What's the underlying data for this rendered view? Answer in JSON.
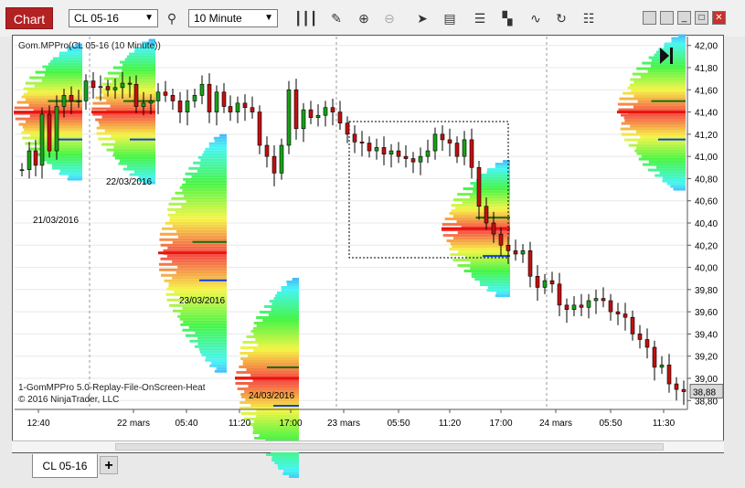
{
  "window": {
    "chart_tab_label": "Chart",
    "instrument": "CL 05-16",
    "interval": "10 Minute"
  },
  "toolbar_icons": [
    "bars-icon",
    "pencil-icon",
    "zoom-in-icon",
    "zoom-out-icon",
    "pointer-icon",
    "data-box-icon",
    "strategies-icon",
    "templates-icon",
    "indicators-icon",
    "reload-icon",
    "properties-icon"
  ],
  "window_controls": [
    "tile-icon",
    "minimize-icon",
    "maximize-icon",
    "close-icon"
  ],
  "chart": {
    "indicator_label": "Gom.MPPro(CL 05-16 (10 Minute))",
    "footer_line1": "1-GomMPPro 5.0-Replay-File-OnScreen-Heat",
    "footer_line2": "© 2016 NinjaTrader, LLC",
    "last_price": "38,88",
    "y_labels": [
      "42,00",
      "41,80",
      "41,60",
      "41,40",
      "41,20",
      "41,00",
      "40,80",
      "40,60",
      "40,40",
      "40,20",
      "40,00",
      "39,80",
      "39,60",
      "39,40",
      "39,20",
      "39,00",
      "38,80"
    ],
    "x_labels": [
      "12:40",
      "22 mars",
      "05:40",
      "11:20",
      "17:00",
      "23 mars",
      "05:50",
      "11:20",
      "17:00",
      "24 mars",
      "05:50",
      "11:30"
    ],
    "session_labels": [
      "21/03/2016",
      "22/03/2016",
      "23/03/2016",
      "24/03/2016"
    ],
    "colors": {
      "poc": "#e8140a",
      "va": "#107010",
      "hvn": "#1040e0",
      "frame": "#555555"
    }
  },
  "tabs": {
    "doc_tab": "CL 05-16",
    "add": "+"
  },
  "chart_data": {
    "type": "candlestick",
    "ylim": [
      38.72,
      42.08
    ],
    "y_ticks": [
      42.0,
      41.8,
      41.6,
      41.4,
      41.2,
      41.0,
      40.8,
      40.6,
      40.4,
      40.2,
      40.0,
      39.8,
      39.6,
      39.4,
      39.2,
      39.0,
      38.8
    ],
    "x_ticks": [
      "12:40",
      "22 mars",
      "05:40",
      "11:20",
      "17:00",
      "23 mars",
      "05:50",
      "11:20",
      "17:00",
      "24 mars",
      "05:50",
      "11:30"
    ],
    "last": 38.88,
    "close_path": [
      [
        0,
        40.88
      ],
      [
        8,
        41.05
      ],
      [
        15,
        40.92
      ],
      [
        22,
        41.38
      ],
      [
        30,
        41.05
      ],
      [
        38,
        41.45
      ],
      [
        46,
        41.55
      ],
      [
        54,
        41.5
      ],
      [
        62,
        41.5
      ],
      [
        70,
        41.68
      ],
      [
        78,
        41.62
      ],
      [
        86,
        41.63
      ],
      [
        94,
        41.6
      ],
      [
        102,
        41.62
      ],
      [
        110,
        41.66
      ],
      [
        118,
        41.65
      ],
      [
        125,
        41.45
      ],
      [
        133,
        41.48
      ],
      [
        141,
        41.5
      ],
      [
        149,
        41.58
      ],
      [
        157,
        41.55
      ],
      [
        165,
        41.5
      ],
      [
        173,
        41.4
      ],
      [
        181,
        41.5
      ],
      [
        189,
        41.55
      ],
      [
        197,
        41.65
      ],
      [
        205,
        41.4
      ],
      [
        213,
        41.58
      ],
      [
        221,
        41.45
      ],
      [
        228,
        41.4
      ],
      [
        236,
        41.48
      ],
      [
        244,
        41.44
      ],
      [
        252,
        41.4
      ],
      [
        260,
        41.1
      ],
      [
        268,
        41.0
      ],
      [
        276,
        40.85
      ],
      [
        284,
        41.1
      ],
      [
        292,
        41.6
      ],
      [
        300,
        41.25
      ],
      [
        308,
        41.42
      ],
      [
        316,
        41.35
      ],
      [
        324,
        41.37
      ],
      [
        332,
        41.44
      ],
      [
        340,
        41.4
      ],
      [
        348,
        41.3
      ],
      [
        356,
        41.2
      ],
      [
        364,
        41.13
      ],
      [
        372,
        41.12
      ],
      [
        380,
        41.05
      ],
      [
        388,
        41.08
      ],
      [
        396,
        41.02
      ],
      [
        404,
        41.05
      ],
      [
        412,
        41.0
      ],
      [
        420,
        40.98
      ],
      [
        428,
        40.95
      ],
      [
        436,
        41.0
      ],
      [
        444,
        41.05
      ],
      [
        452,
        41.2
      ],
      [
        460,
        41.15
      ],
      [
        468,
        41.12
      ],
      [
        476,
        41.0
      ],
      [
        484,
        41.15
      ],
      [
        492,
        40.9
      ],
      [
        500,
        40.55
      ],
      [
        508,
        40.4
      ],
      [
        516,
        40.3
      ],
      [
        524,
        40.2
      ],
      [
        532,
        40.15
      ],
      [
        540,
        40.12
      ],
      [
        548,
        40.15
      ],
      [
        556,
        39.92
      ],
      [
        564,
        39.82
      ],
      [
        572,
        39.88
      ],
      [
        580,
        39.85
      ],
      [
        588,
        39.66
      ],
      [
        596,
        39.62
      ],
      [
        604,
        39.66
      ],
      [
        612,
        39.64
      ],
      [
        620,
        39.7
      ],
      [
        628,
        39.72
      ],
      [
        636,
        39.7
      ],
      [
        644,
        39.6
      ],
      [
        652,
        39.58
      ],
      [
        660,
        39.55
      ],
      [
        668,
        39.4
      ],
      [
        676,
        39.35
      ],
      [
        684,
        39.28
      ],
      [
        692,
        39.1
      ],
      [
        700,
        39.12
      ],
      [
        708,
        38.95
      ],
      [
        716,
        38.9
      ],
      [
        724,
        38.88
      ]
    ],
    "sessions": [
      {
        "label": "21/03/2016",
        "poc": 41.4
      },
      {
        "label": "22/03/2016",
        "poc": 41.4
      },
      {
        "label": "23/03/2016",
        "poc": 40.13
      },
      {
        "label": "24/03/2016",
        "poc": 39.0
      }
    ]
  }
}
